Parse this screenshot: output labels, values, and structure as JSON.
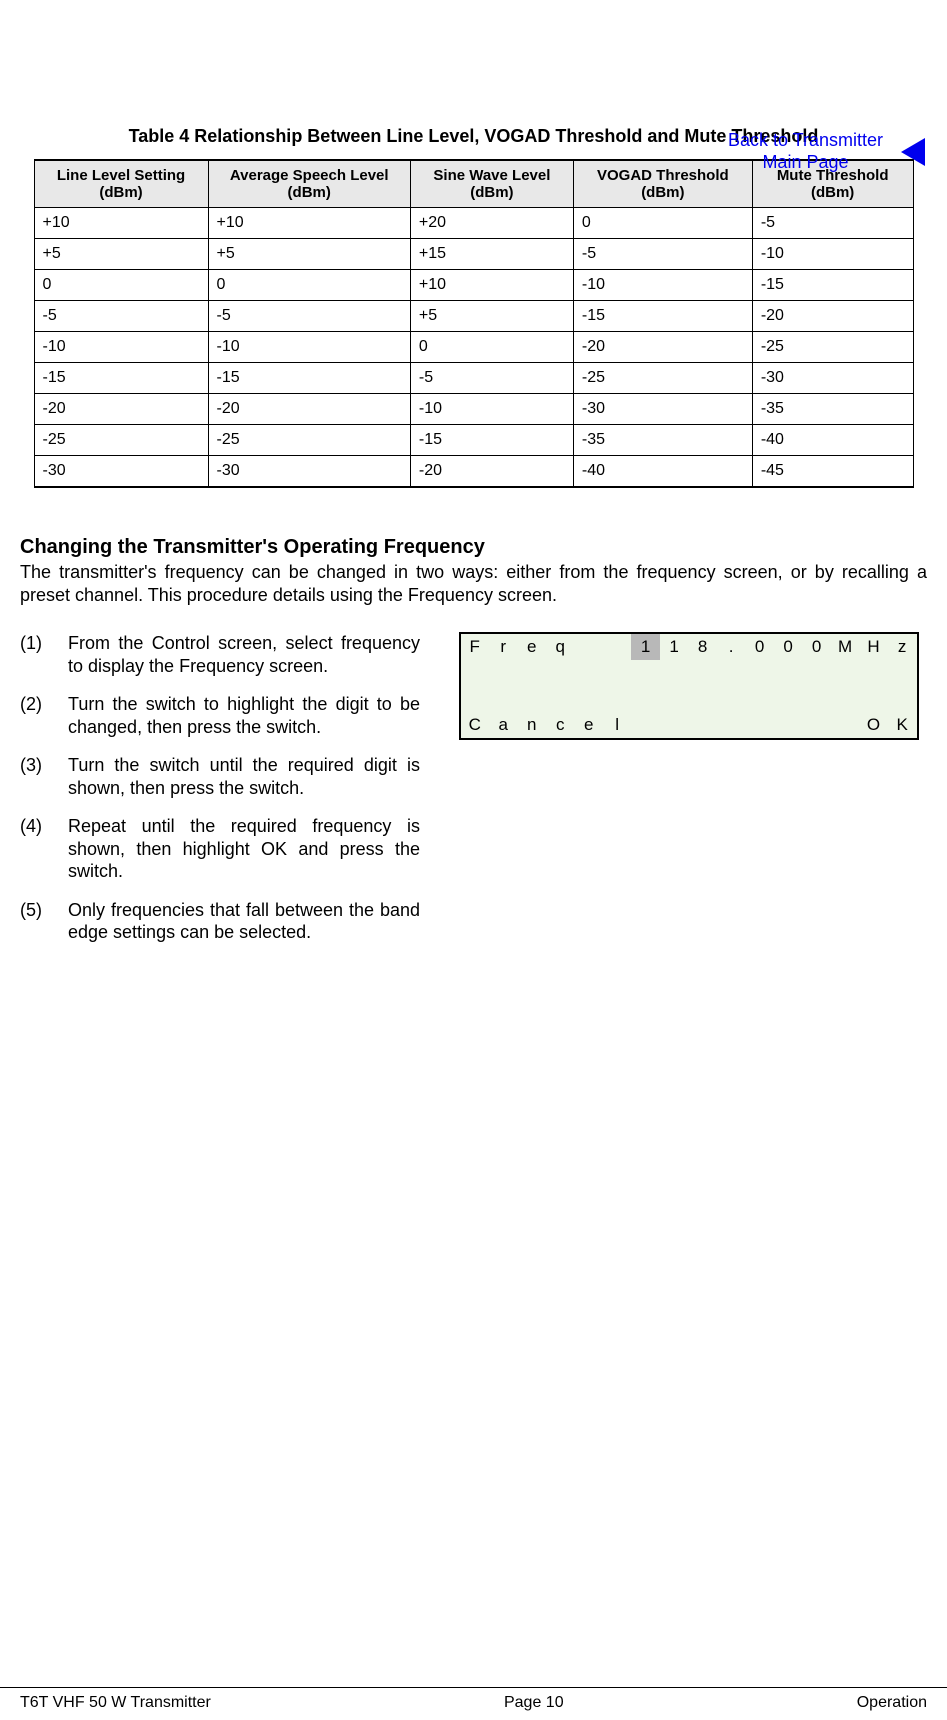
{
  "header": {
    "back_link_line1": "Back to Transmitter",
    "back_link_line2": "Main Page"
  },
  "table": {
    "caption": "Table 4  Relationship Between Line Level, VOGAD Threshold and Mute Threshold",
    "headers": [
      "Line Level Setting (dBm)",
      "Average Speech Level (dBm)",
      "Sine Wave Level (dBm)",
      "VOGAD Threshold (dBm)",
      "Mute Threshold (dBm)"
    ],
    "rows": [
      [
        "+10",
        "+10",
        "+20",
        "0",
        "-5"
      ],
      [
        "+5",
        "+5",
        "+15",
        "-5",
        "-10"
      ],
      [
        "0",
        "0",
        "+10",
        "-10",
        "-15"
      ],
      [
        "-5",
        "-5",
        "+5",
        "-15",
        "-20"
      ],
      [
        "-10",
        "-10",
        "0",
        "-20",
        "-25"
      ],
      [
        "-15",
        "-15",
        "-5",
        "-25",
        "-30"
      ],
      [
        "-20",
        "-20",
        "-10",
        "-30",
        "-35"
      ],
      [
        "-25",
        "-25",
        "-15",
        "-35",
        "-40"
      ],
      [
        "-30",
        "-30",
        "-20",
        "-40",
        "-45"
      ]
    ]
  },
  "section": {
    "heading": "Changing the Transmitter's Operating Frequency",
    "para": "The transmitter's frequency can be changed in two ways: either from the frequency screen, or by recalling a preset channel. This procedure details using the Frequency screen."
  },
  "steps": [
    {
      "num": "(1)",
      "text": "From the Control screen, select frequency to display the Frequency screen."
    },
    {
      "num": "(2)",
      "text": "Turn the switch to highlight the digit to be changed, then press the switch."
    },
    {
      "num": "(3)",
      "text": "Turn the switch until the required digit is shown, then press the switch."
    },
    {
      "num": "(4)",
      "text": "Repeat until the required frequency is shown, then highlight OK and press the switch."
    },
    {
      "num": "(5)",
      "text": "Only frequencies that fall between the band edge settings can be selected."
    }
  ],
  "lcd": {
    "row1": [
      "F",
      "r",
      "e",
      "q",
      "",
      "",
      "1",
      "1",
      "8",
      ".",
      "0",
      "0",
      "0",
      "M",
      "H",
      "z"
    ],
    "highlight_col": 6,
    "row4": [
      "C",
      "a",
      "n",
      "c",
      "e",
      "l",
      "",
      "",
      "",
      "",
      "",
      "",
      "",
      "",
      "O",
      "K"
    ]
  },
  "footer": {
    "left": "T6T VHF 50 W Transmitter",
    "center": "Page 10",
    "right": "Operation"
  }
}
